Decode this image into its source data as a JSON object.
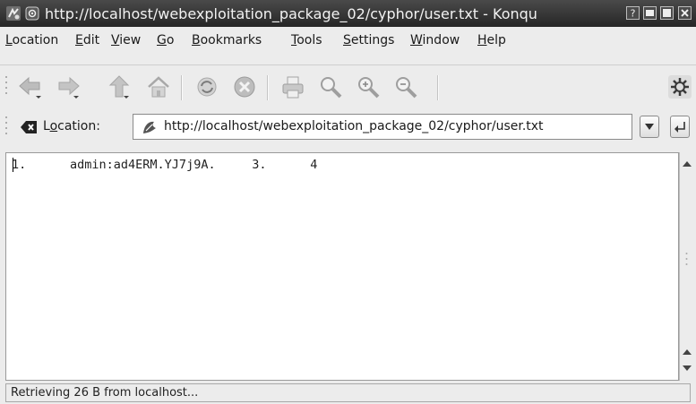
{
  "window": {
    "title": "http://localhost/webexploitation_package_02/cyphor/user.txt - Konqu"
  },
  "menubar": {
    "items": [
      {
        "label": "Location",
        "mnemonic": "L"
      },
      {
        "label": "Edit",
        "mnemonic": "E"
      },
      {
        "label": "View",
        "mnemonic": "V"
      },
      {
        "label": "Go",
        "mnemonic": "G"
      },
      {
        "label": "Bookmarks",
        "mnemonic": "B"
      },
      {
        "label": "Tools",
        "mnemonic": "T"
      },
      {
        "label": "Settings",
        "mnemonic": "S"
      },
      {
        "label": "Window",
        "mnemonic": "W"
      },
      {
        "label": "Help",
        "mnemonic": "H"
      }
    ]
  },
  "toolbar": {
    "buttons": [
      {
        "icon": "back-arrow-icon"
      },
      {
        "icon": "forward-arrow-icon"
      },
      {
        "icon": "up-arrow-icon"
      },
      {
        "icon": "home-icon"
      },
      {
        "icon": "reload-icon"
      },
      {
        "icon": "stop-icon"
      },
      {
        "icon": "print-icon"
      },
      {
        "icon": "zoom-icon"
      },
      {
        "icon": "zoom-in-icon"
      },
      {
        "icon": "zoom-out-icon"
      }
    ]
  },
  "location": {
    "label": "Location:",
    "mnemonic": "o",
    "url": "http://localhost/webexploitation_package_02/cyphor/user.txt"
  },
  "content": {
    "text": "1.      admin:ad4ERM.YJ7j9A.     3.      4"
  },
  "status": {
    "text": "Retrieving 26 B from localhost..."
  },
  "colors": {
    "titlebar": "#2e2e2e",
    "background": "#ececec",
    "content_bg": "#ffffff"
  }
}
